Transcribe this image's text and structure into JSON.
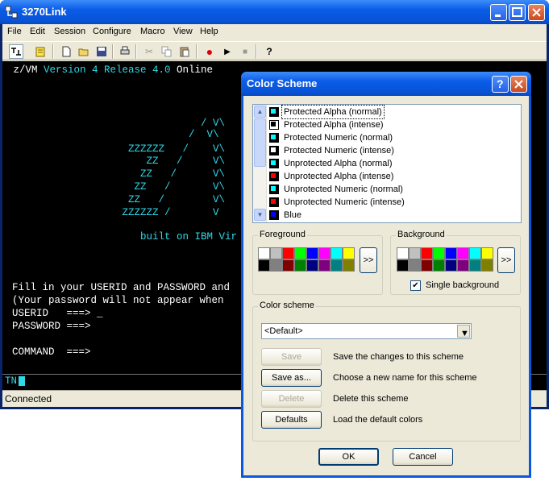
{
  "app": {
    "title": "3270Link",
    "menu": [
      "File",
      "Edit",
      "Session",
      "Configure",
      "Macro",
      "View",
      "Help"
    ],
    "status": "Connected",
    "tn_label": "TN"
  },
  "terminal": {
    "header_prefix": " z/VM ",
    "header_version": "Version 4 Release 4.0",
    "header_suffix": " Online",
    "logo_lines": [
      "                    / V\\",
      "                  /  V\\",
      "        ZZZZZZ   /    V\\",
      "           ZZ   /     V\\",
      "          ZZ   /      V\\",
      "         ZZ   /       V\\",
      "        ZZ   /        V\\",
      "       ZZZZZZ /       V"
    ],
    "built_on": "          built on IBM Vir",
    "fill_line": "Fill in your USERID and PASSWORD and",
    "password_note": "(Your password will not appear when",
    "userid_label": "USERID   ===> _",
    "password_label": "PASSWORD ===>",
    "command_label": "COMMAND  ===>"
  },
  "dialog": {
    "title": "Color Scheme",
    "items": [
      {
        "label": "Protected Alpha (normal)",
        "fg": "#00ffff",
        "bg": "#000000"
      },
      {
        "label": "Protected Alpha (intense)",
        "fg": "#000000",
        "bg": "#ffffff"
      },
      {
        "label": "Protected Numeric (normal)",
        "fg": "#00ffff",
        "bg": "#000000"
      },
      {
        "label": "Protected Numeric (intense)",
        "fg": "#ffffff",
        "bg": "#000000"
      },
      {
        "label": "Unprotected Alpha (normal)",
        "fg": "#00ffff",
        "bg": "#000000"
      },
      {
        "label": "Unprotected Alpha (intense)",
        "fg": "#ff0000",
        "bg": "#000000"
      },
      {
        "label": "Unprotected Numeric (normal)",
        "fg": "#00ffff",
        "bg": "#000000"
      },
      {
        "label": "Unprotected Numeric (intense)",
        "fg": "#ff0000",
        "bg": "#000000"
      },
      {
        "label": "Blue",
        "fg": "#0000ff",
        "bg": "#000000"
      }
    ],
    "foreground_label": "Foreground",
    "background_label": "Background",
    "palette": [
      "#ffffff",
      "#c0c0c0",
      "#ff0000",
      "#00ff00",
      "#0000ff",
      "#ff00ff",
      "#00ffff",
      "#ffff00",
      "#000000",
      "#808080",
      "#800000",
      "#008000",
      "#000080",
      "#800080",
      "#008080",
      "#808000"
    ],
    "more_label": ">>",
    "single_background_label": "Single background",
    "single_background_checked": "✔",
    "scheme_group_label": "Color scheme",
    "scheme_value": "<Default>",
    "buttons": {
      "save": "Save",
      "save_as": "Save as...",
      "delete": "Delete",
      "defaults": "Defaults",
      "ok": "OK",
      "cancel": "Cancel"
    },
    "descriptions": {
      "save": "Save the changes to this scheme",
      "save_as": "Choose a new name for this scheme",
      "delete": "Delete this scheme",
      "defaults": "Load the default colors"
    }
  }
}
